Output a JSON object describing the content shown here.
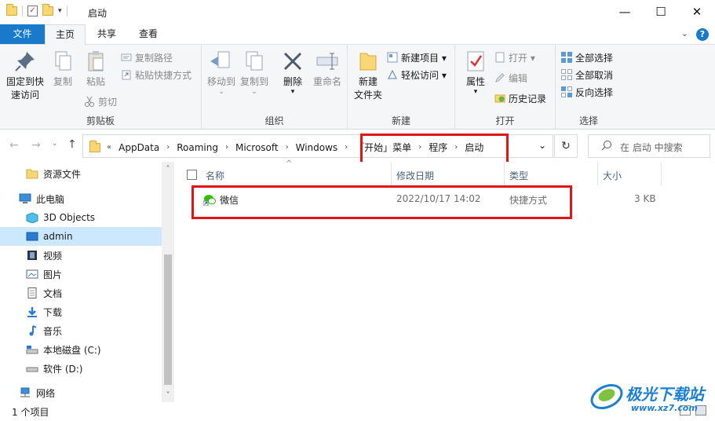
{
  "window": {
    "title": "启动",
    "minimize": "—",
    "maximize": "☐",
    "close": "✕"
  },
  "menu": {
    "file": "文件",
    "home": "主页",
    "share": "共享",
    "view": "查看",
    "collapse": "⌄",
    "help": "?"
  },
  "ribbon": {
    "clipboard": {
      "label": "剪贴板",
      "pin_line1": "固定到快",
      "pin_line2": "速访问",
      "copy": "复制",
      "paste": "粘贴",
      "copy_path": "复制路径",
      "paste_shortcut": "粘贴快捷方式",
      "cut": "剪切"
    },
    "organize": {
      "label": "组织",
      "move_to": "移动到",
      "copy_to": "复制到",
      "delete": "删除",
      "rename": "重命名"
    },
    "new": {
      "label": "新建",
      "new_folder_line1": "新建",
      "new_folder_line2": "文件夹",
      "new_item": "新建项目 ▾",
      "easy_access": "轻松访问 ▾"
    },
    "open": {
      "label": "打开",
      "properties": "属性",
      "open": "打开 ▾",
      "edit": "编辑",
      "history": "历史记录"
    },
    "select": {
      "label": "选择",
      "select_all": "全部选择",
      "select_none": "全部取消",
      "invert": "反向选择"
    }
  },
  "address": {
    "chevron": "«",
    "crumbs": [
      "AppData",
      "Roaming",
      "Microsoft",
      "Windows",
      "「开始」菜单",
      "程序",
      "启动"
    ],
    "dropdown": "⌄",
    "refresh": "↻",
    "search_placeholder": "在 启动 中搜索"
  },
  "nav": {
    "items": [
      {
        "label": "资源文件",
        "icon": "folder-icon"
      },
      {
        "label": "此电脑",
        "icon": "computer-icon"
      },
      {
        "label": "3D Objects",
        "icon": "3d-objects-icon"
      },
      {
        "label": "admin",
        "icon": "desktop-icon"
      },
      {
        "label": "视频",
        "icon": "video-icon"
      },
      {
        "label": "图片",
        "icon": "picture-icon"
      },
      {
        "label": "文档",
        "icon": "document-icon"
      },
      {
        "label": "下载",
        "icon": "download-icon"
      },
      {
        "label": "音乐",
        "icon": "music-icon"
      },
      {
        "label": "本地磁盘 (C:)",
        "icon": "drive-c-icon"
      },
      {
        "label": "软件 (D:)",
        "icon": "drive-d-icon"
      },
      {
        "label": "网络",
        "icon": "network-icon"
      }
    ]
  },
  "columns": {
    "name": "名称",
    "date": "修改日期",
    "type": "类型",
    "size": "大小",
    "sort_arrow": "^"
  },
  "files": [
    {
      "name": "微信",
      "date": "2022/10/17 14:02",
      "type": "快捷方式",
      "size": "3 KB"
    }
  ],
  "status": {
    "count": "1 个项目"
  },
  "watermark": {
    "brand": "极光下载站",
    "url": "www.xz7.com"
  },
  "colors": {
    "accent": "#1979ca",
    "highlight": "#e31414",
    "selection": "#cce8ff"
  }
}
